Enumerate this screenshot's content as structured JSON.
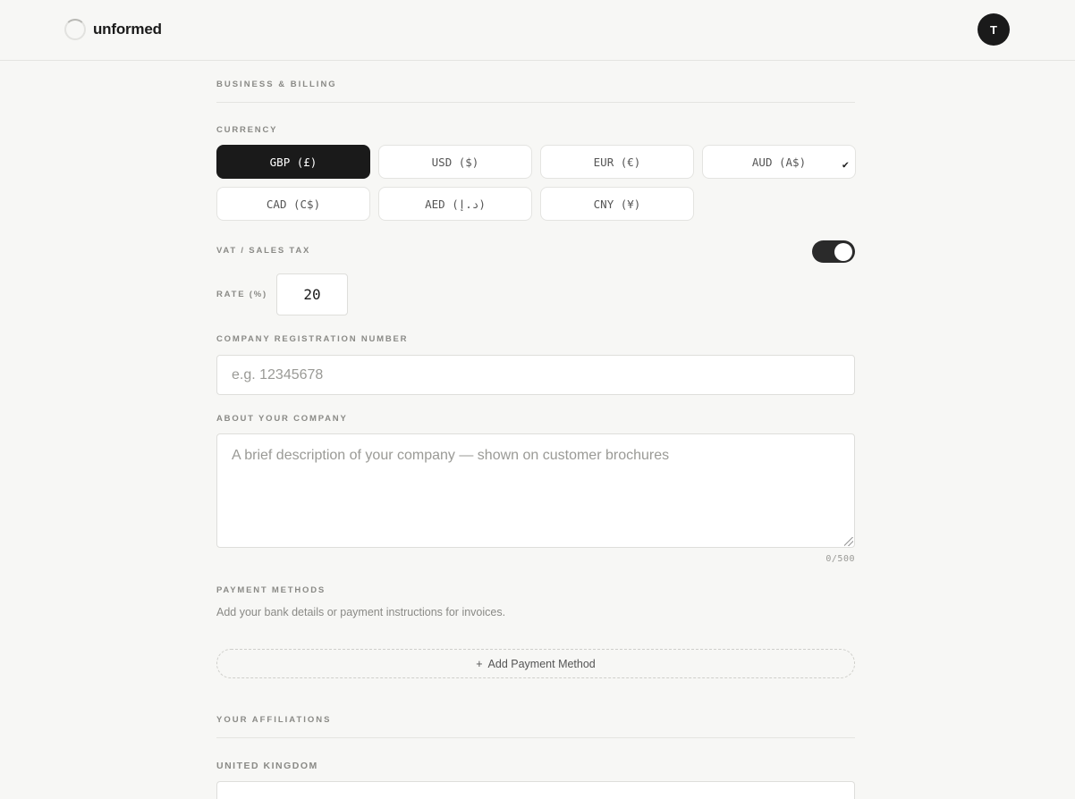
{
  "header": {
    "brand_name": "unformed",
    "avatar_initial": "T"
  },
  "billing": {
    "section_title": "BUSINESS & BILLING",
    "currency_label": "CURRENCY",
    "currencies": [
      {
        "label": "GBP (£)",
        "selected": true
      },
      {
        "label": "USD ($)",
        "selected": false
      },
      {
        "label": "EUR (€)",
        "selected": false
      },
      {
        "label": "AUD (A$)",
        "selected": false,
        "check": "✔"
      },
      {
        "label": "CAD (C$)",
        "selected": false
      },
      {
        "label": "AED (د.إ)",
        "selected": false
      },
      {
        "label": "CNY (¥)",
        "selected": false
      }
    ],
    "vat_label": "VAT / SALES TAX",
    "vat_enabled": true,
    "rate_label": "RATE (%)",
    "rate_value": "20",
    "company_reg_label": "COMPANY REGISTRATION NUMBER",
    "company_reg_placeholder": "e.g. 12345678",
    "about_label": "ABOUT YOUR COMPANY",
    "about_placeholder": "A brief description of your company — shown on customer brochures",
    "about_counter": "0/500",
    "payment_label": "PAYMENT METHODS",
    "payment_helper": "Add your bank details or payment instructions for invoices.",
    "add_payment_icon": "+",
    "add_payment_label": "Add Payment Method"
  },
  "affiliations": {
    "section_title": "YOUR AFFILIATIONS",
    "country_label": "UNITED KINGDOM"
  },
  "colors": {
    "accent": "#1a1a1a",
    "background": "#f7f7f5"
  }
}
